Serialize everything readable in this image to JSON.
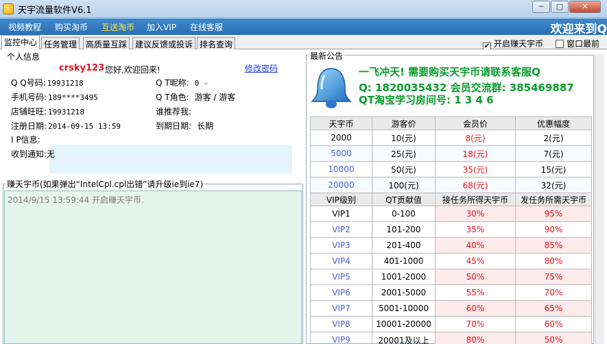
{
  "window": {
    "title": "天宇流量软件V6.1",
    "min": "─",
    "max": "□",
    "close": "✕"
  },
  "menu": {
    "items": [
      "视频教程",
      "购买淘币",
      "互送淘币",
      "加入VIP",
      "在线客服"
    ],
    "welcome": "欢迎来到Q"
  },
  "tabs": [
    "监控中心",
    "任务管理",
    "高质量互踩",
    "建议反馈或投诉",
    "排名查询"
  ],
  "options": {
    "earn_label": "开启赚天宇币",
    "earn_checked": "✔",
    "topmost_label": "窗口最前"
  },
  "personal": {
    "section": "个人信息",
    "username": "crsky123",
    "greeting": "您好,欢迎回来!",
    "change_password": "修改密码",
    "qq_label": "Q Q号码:",
    "qq_value": "19931218",
    "nickname_label": "Q T昵称:",
    "nickname_value": "0 -",
    "phone_label": "手机号码:",
    "phone_value": "189****3495",
    "role_label": "Q T角色:",
    "role_value": "游客 / 游客",
    "wangwang_label": "店铺旺旺:",
    "wangwang_value": "19931218",
    "referrer_label": "谁推荐我:",
    "referrer_value": "",
    "register_label": "注册日期:",
    "register_value": "2014-09-15 13:59",
    "expire_label": "到期日期:",
    "expire_value": "长期",
    "ip_label": "I P信息:",
    "ip_value": "",
    "notice_label": "收到通知:",
    "notice_value": "无"
  },
  "earn": {
    "section": "赚天宇币(如果弹出“IntelCpl.cpl出错”请升级ie到ie7)",
    "log": "2014/9/15 13:59:44 开启赚天宇币."
  },
  "announcement": {
    "section": "最新公告",
    "line1": "一飞冲天! 需要购买天宇币请联系客服Q",
    "line2": "Q: 1820035432  会员交流群: 385469887",
    "line3": "QT淘宝学习房间号: 1 3 4 6"
  },
  "price_table": {
    "headers": [
      "天宇币",
      "游客价",
      "会员价",
      "优惠幅度"
    ],
    "rows": [
      [
        "2000",
        "10(元)",
        "8(元)",
        "2(元)"
      ],
      [
        "5000",
        "25(元)",
        "18(元)",
        "7(元)"
      ],
      [
        "10000",
        "50(元)",
        "35(元)",
        "15(元)"
      ],
      [
        "20000",
        "100(元)",
        "68(元)",
        "32(元)"
      ]
    ]
  },
  "vip_table": {
    "headers": [
      "VIP级别",
      "QT贡献值",
      "接任务所得天宇币",
      "发任务所需天宇币"
    ],
    "rows": [
      [
        "VIP1",
        "0-100",
        "30%",
        "95%"
      ],
      [
        "VIP2",
        "101-200",
        "35%",
        "90%"
      ],
      [
        "VIP3",
        "201-400",
        "40%",
        "85%"
      ],
      [
        "VIP4",
        "401-1000",
        "45%",
        "80%"
      ],
      [
        "VIP5",
        "1001-2000",
        "50%",
        "75%"
      ],
      [
        "VIP6",
        "2001-5000",
        "55%",
        "70%"
      ],
      [
        "VIP7",
        "5001-10000",
        "60%",
        "65%"
      ],
      [
        "VIP8",
        "10001-20000",
        "70%",
        "60%"
      ],
      [
        "VIP9",
        "20001及以上",
        "80%",
        "50%"
      ]
    ]
  },
  "colors": {
    "menu_bg": "#2a6fb2",
    "accent_red": "#e8101a",
    "announcement_green": "#0a9b2c",
    "highlight_blue": "#4a5fd8"
  }
}
